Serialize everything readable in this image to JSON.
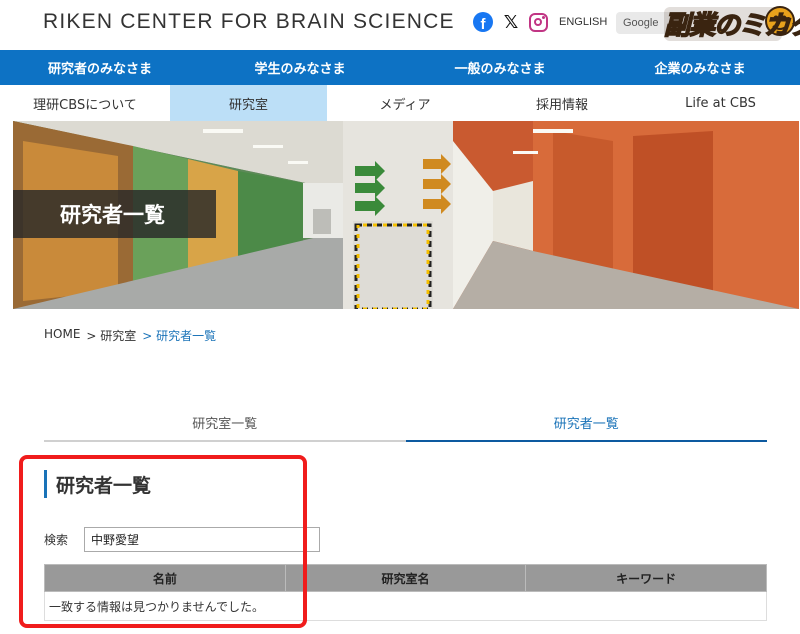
{
  "header": {
    "site_title": "RIKEN CENTER FOR BRAIN SCIENCE",
    "social_icons": [
      "facebook-icon",
      "x-icon",
      "instagram-icon"
    ],
    "language_link": "ENGLISH",
    "search_label": "Google",
    "overlay_logo_text": "副業のミカタ"
  },
  "nav_main": {
    "items": [
      {
        "label": "研究者のみなさま"
      },
      {
        "label": "学生のみなさま"
      },
      {
        "label": "一般のみなさま"
      },
      {
        "label": "企業のみなさま"
      }
    ],
    "background": "#0d72c4"
  },
  "nav_sub": {
    "items": [
      {
        "label": "理研CBSについて"
      },
      {
        "label": "研究室",
        "active": true
      },
      {
        "label": "メディア"
      },
      {
        "label": "採用情報"
      },
      {
        "label": "Life at CBS"
      }
    ],
    "active_color": "#bcdff7"
  },
  "hero": {
    "title": "研究者一覧"
  },
  "breadcrumb": {
    "items": [
      {
        "label": "HOME"
      },
      {
        "label": "> 研究室"
      },
      {
        "label": "> 研究者一覧",
        "current": true
      }
    ]
  },
  "tabs": {
    "items": [
      {
        "label": "研究室一覧"
      },
      {
        "label": "研究者一覧",
        "active": true
      }
    ]
  },
  "main": {
    "section_title": "研究者一覧",
    "search": {
      "label": "検索",
      "value": "中野愛望"
    },
    "table": {
      "headers": [
        "名前",
        "研究室名",
        "キーワード"
      ],
      "empty_message": "一致する情報は見つかりませんでした。"
    }
  },
  "colors": {
    "accent_blue": "#0d72c4",
    "link_blue": "#1a73b8",
    "highlight_red": "#f01c1c"
  }
}
